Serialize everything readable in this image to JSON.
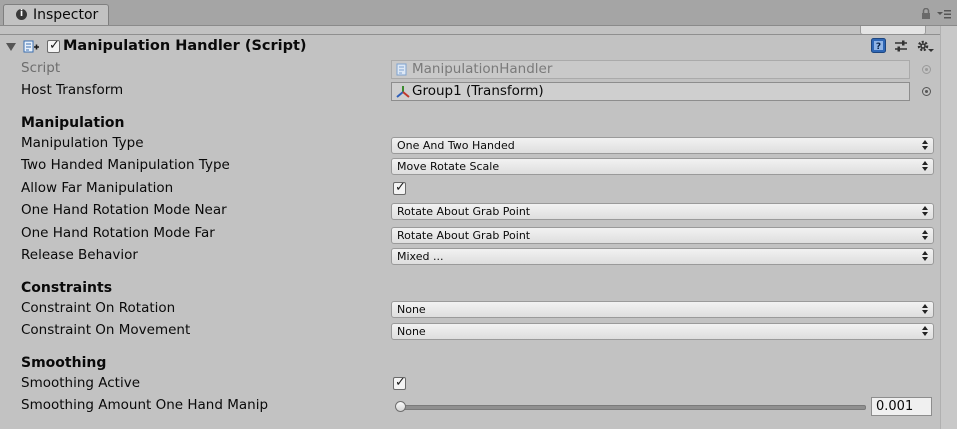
{
  "tab": {
    "title": "Inspector"
  },
  "component": {
    "title": "Manipulation Handler (Script)",
    "enabled": true
  },
  "script_row": {
    "label": "Script",
    "value": "ManipulationHandler"
  },
  "host_row": {
    "label": "Host Transform",
    "value": "Group1 (Transform)"
  },
  "sections": {
    "manipulation": "Manipulation",
    "constraints": "Constraints",
    "smoothing": "Smoothing"
  },
  "fields": {
    "manipulation_type": {
      "label": "Manipulation Type",
      "value": "One And Two Handed"
    },
    "two_handed_type": {
      "label": "Two Handed Manipulation Type",
      "value": "Move Rotate Scale"
    },
    "allow_far": {
      "label": "Allow Far Manipulation",
      "checked": true
    },
    "rot_mode_near": {
      "label": "One Hand Rotation Mode Near",
      "value": "Rotate About Grab Point"
    },
    "rot_mode_far": {
      "label": "One Hand Rotation Mode Far",
      "value": "Rotate About Grab Point"
    },
    "release_behavior": {
      "label": "Release Behavior",
      "value": "Mixed ..."
    },
    "constraint_rotation": {
      "label": "Constraint On Rotation",
      "value": "None"
    },
    "constraint_movement": {
      "label": "Constraint On Movement",
      "value": "None"
    },
    "smoothing_active": {
      "label": "Smoothing Active",
      "checked": true
    },
    "smoothing_amount": {
      "label": "Smoothing Amount One Hand Manip",
      "value": "0.001",
      "fraction": 0.001
    }
  },
  "icons": {
    "tab": "info-icon",
    "lock": "lock-icon",
    "menu": "menu-icon",
    "foldout": "foldout-arrow-icon",
    "component": "script-component-icon",
    "help": "help-icon",
    "presets": "presets-icon",
    "settings": "gear-icon",
    "transform": "transform-icon",
    "picker": "object-picker-icon"
  },
  "colors": {
    "panel": "#c2c2c2",
    "tab_strip": "#a5a5a5",
    "help_blue": "#2f67b5"
  }
}
